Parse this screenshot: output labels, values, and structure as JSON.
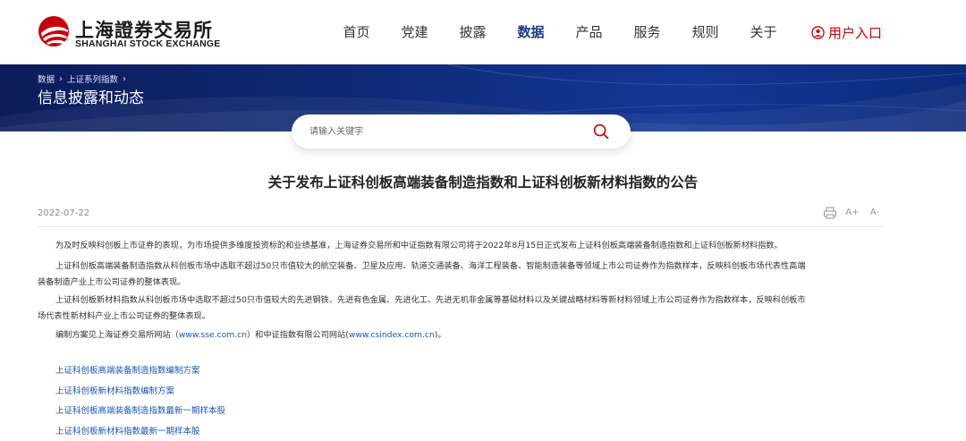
{
  "header": {
    "logo_cn": "上海證券交易所",
    "logo_en": "SHANGHAI STOCK EXCHANGE",
    "nav": [
      {
        "label": "首页"
      },
      {
        "label": "党建"
      },
      {
        "label": "披露"
      },
      {
        "label": "数据"
      },
      {
        "label": "产品"
      },
      {
        "label": "服务"
      },
      {
        "label": "规则"
      },
      {
        "label": "关于"
      }
    ],
    "active_nav": "数据",
    "login_label": "用户入口"
  },
  "banner": {
    "breadcrumb": [
      "数据",
      "上证系列指数"
    ],
    "title": "信息披露和动态"
  },
  "search": {
    "placeholder": "请输入关键字"
  },
  "article": {
    "title": "关于发布上证科创板高端装备制造指数和上证科创板新材料指数的公告",
    "date": "2022-07-22",
    "p1": "为及时反映科创板上市证券的表现，为市场提供多维度投资标的和业绩基准，上海证券交易所和中证指数有限公司将于2022年8月15日正式发布上证科创板高端装备制造指数和上证科创板新材料指数。",
    "p2_line1": "上证科创板高端装备制造指数从科创板市场中选取不超过50只市值较大的航空装备、卫星及应用、轨道交通装备、海洋工程装备、智能制造装备等领域上市公司证券作为指数样本，反映科创板市场代表性高端",
    "p2_line2": "装备制造产业上市公司证券的整体表现。",
    "p3_line1": "上证科创板新材料指数从科创板市场中选取不超过50只市值较大的先进钢铁、先进有色金属、先进化工、先进无机非金属等基础材料以及关键战略材料等新材料领域上市公司证券作为指数样本，反映科创板市",
    "p3_line2": "场代表性新材料产业上市公司证券的整体表现。",
    "p4_prefix": "编制方案见上海证券交易所网站（",
    "p4_link1": "www.sse.com.cn",
    "p4_middle": "）和中证指数有限公司网站(",
    "p4_link2": "www.csindex.com.cn",
    "p4_suffix": ")。"
  },
  "links": [
    {
      "label": "上证科创板高端装备制造指数编制方案"
    },
    {
      "label": "上证科创板新材料指数编制方案"
    },
    {
      "label": "上证科创板高端装备制造指数最新一期样本股"
    },
    {
      "label": "上证科创板新材料指数最新一期样本股"
    }
  ],
  "tools": {
    "font_increase": "A+",
    "font_decrease": "A-"
  },
  "colors": {
    "brand_red": "#c7000b",
    "nav_active": "#1a3a8c",
    "link": "#1a54b5",
    "banner": "#0f2a78"
  }
}
